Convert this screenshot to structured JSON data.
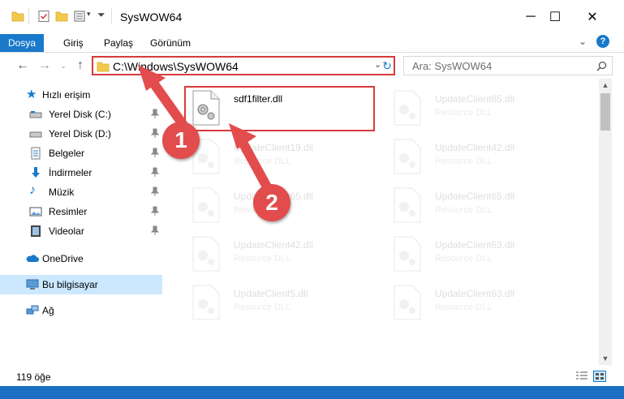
{
  "window": {
    "title": "SysWOW64",
    "minimize_label": "─",
    "maximize_label": "☐",
    "close_label": "✕"
  },
  "ribbon": {
    "tabs": [
      {
        "label": "Dosya",
        "active": true
      },
      {
        "label": "Giriş"
      },
      {
        "label": "Paylaş"
      },
      {
        "label": "Görünüm"
      }
    ],
    "help_label": "?"
  },
  "address": {
    "path": "C:\\Windows\\SysWOW64",
    "search_placeholder": "Ara: SysWOW64"
  },
  "nav": {
    "items": [
      {
        "label": "Hızlı erişim",
        "icon": "star-icon"
      },
      {
        "label": "Yerel Disk (C:)",
        "icon": "drive-icon",
        "pinned": true
      },
      {
        "label": "Yerel Disk (D:)",
        "icon": "drive-icon",
        "pinned": true
      },
      {
        "label": "Belgeler",
        "icon": "document-icon",
        "pinned": true
      },
      {
        "label": "İndirmeler",
        "icon": "download-icon",
        "pinned": true
      },
      {
        "label": "Müzik",
        "icon": "music-icon",
        "pinned": true
      },
      {
        "label": "Resimler",
        "icon": "pictures-icon",
        "pinned": true
      },
      {
        "label": "Videolar",
        "icon": "video-icon",
        "pinned": true
      },
      {
        "label": "OneDrive",
        "icon": "cloud-icon"
      },
      {
        "label": "Bu bilgisayar",
        "icon": "computer-icon",
        "selected": true
      },
      {
        "label": "Ağ",
        "icon": "network-icon"
      }
    ]
  },
  "files": {
    "left": [
      {
        "name": "sdf1filter.dll",
        "type": ""
      },
      {
        "name": "UpdateClient19.dll",
        "type": "Resource DLL"
      },
      {
        "name": "UpdateClient65.dll",
        "type": "Resource DLL"
      },
      {
        "name": "UpdateClient42.dll",
        "type": "Resource DLL"
      },
      {
        "name": "UpdateClient5.dll",
        "type": "Resource DLL"
      }
    ],
    "right": [
      {
        "name": "UpdateClient65.dll",
        "type": "Resource DLL"
      },
      {
        "name": "UpdateClient42.dll",
        "type": "Resource DLL"
      },
      {
        "name": "UpdateClient65.dll",
        "type": "Resource DLL"
      },
      {
        "name": "UpdateClient63.dll",
        "type": "Resource DLL"
      },
      {
        "name": "UpdateClient63.dll",
        "type": "Resource DLL"
      }
    ]
  },
  "status": {
    "item_count": "119 öğe"
  },
  "annotations": {
    "marker1": "1",
    "marker2": "2",
    "color": "#e24c4c"
  },
  "colors": {
    "accent": "#1979ca",
    "highlight": "#d83a3a",
    "selection": "#cce8ff"
  }
}
